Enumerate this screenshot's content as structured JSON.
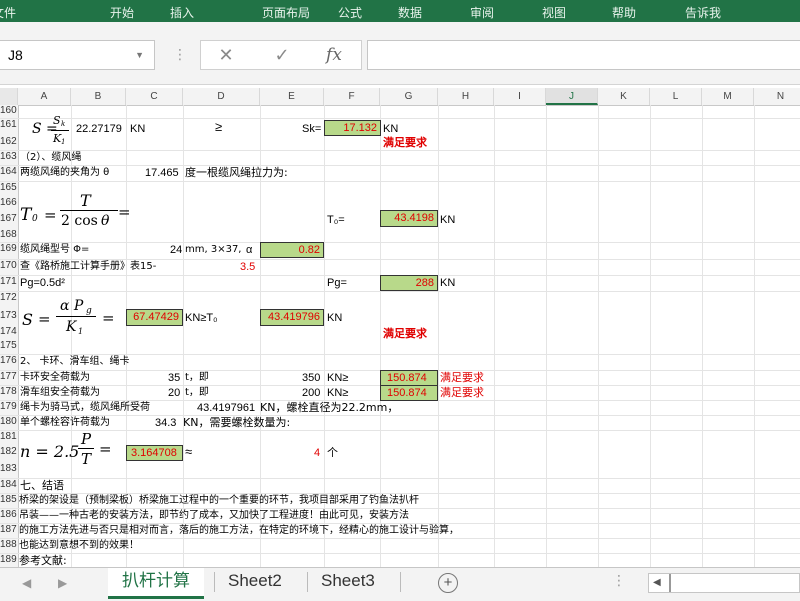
{
  "ribbon": {
    "tabs": [
      "文件",
      "开始",
      "插入",
      "页面布局",
      "公式",
      "数据",
      "审阅",
      "视图",
      "帮助",
      "告诉我"
    ]
  },
  "formula_bar": {
    "cell_ref": "J8",
    "cancel_symbol": "✕",
    "confirm_symbol": "✓",
    "fx_symbol": "fx",
    "formula_value": ""
  },
  "columns": [
    "A",
    "B",
    "C",
    "D",
    "E",
    "F",
    "G",
    "H",
    "I",
    "J",
    "K",
    "L",
    "M",
    "N"
  ],
  "selected_column": "J",
  "rows": [
    "160",
    "161",
    "162",
    "163",
    "164",
    "165",
    "166",
    "167",
    "168",
    "169",
    "170",
    "171",
    "172",
    "173",
    "174",
    "175",
    "176",
    "177",
    "178",
    "179",
    "180",
    "181",
    "182",
    "183",
    "184",
    "185",
    "186",
    "187",
    "188",
    "189"
  ],
  "cells": {
    "r161_s": "S =",
    "r161_sk": "S",
    "r161_sk_sub": "k",
    "r161_k1": "K",
    "r161_k1_sub": "1",
    "r161_b": "22.27179",
    "r161_c": "KN",
    "r161_d": "≥",
    "r161_e": "Sk=",
    "r161_f": "17.132",
    "r161_g": "KN",
    "r162_g": "满足要求",
    "r163_a": "（2）、缆风绳",
    "r164_a": "两缆风绳的夹角为 θ",
    "r164_c": "17.465",
    "r164_d": "度一根缆风绳拉力为:",
    "r167_t0": "T",
    "r167_t0_sub": "0",
    "r167_eq": "=",
    "r167_T": "T",
    "r167_den": "2 cos",
    "r167_theta": "θ",
    "r167_eq2": "=",
    "r167_f": "T₀=",
    "r167_g": "43.4198",
    "r167_h": "KN",
    "r169_a": "缆风绳型号 Φ=",
    "r169_c": "24",
    "r169_d": "mm, 3×37,",
    "r169_alpha": "α",
    "r169_e": "0.82",
    "r170_a": "查《路桥施工计算手册》表15-",
    "r170_d": "3.5",
    "r171_a": "Pg=0.5d²",
    "r171_f": "Pg=",
    "r171_g": "288",
    "r171_h": "KN",
    "r173_s": "S",
    "r173_eq": "=",
    "r173_num": "α P",
    "r173_num_sub": "g",
    "r173_den": "K",
    "r173_den_sub": "1",
    "r173_eq2": "=",
    "r173_c": "67.47429",
    "r173_d": "KN≥T₀",
    "r173_e": "43.419796",
    "r173_f": "KN",
    "r174_g": "满足要求",
    "r176_a": "2、 卡环、滑车组、绳卡",
    "r177_a": "卡环安全荷载为",
    "r177_c": "35",
    "r177_d": "t，即",
    "r177_e": "350",
    "r177_f": "KN≥",
    "r177_g": "150.874",
    "r177_h": "满足要求",
    "r178_a": "滑车组安全荷载为",
    "r178_c": "20",
    "r178_d": "t，即",
    "r178_e": "200",
    "r178_f": "KN≥",
    "r178_g": "150.874",
    "r178_h": "满足要求",
    "r179_a": "绳卡为骑马式，缆风绳所受荷",
    "r179_c": "43.4197961",
    "r179_d": "KN，螺栓直径为22.2mm，",
    "r180_a": "单个螺栓容许荷载为",
    "r180_c": "34.3",
    "r180_d": "KN，需要螺栓数量为:",
    "r182_n": "n = 2.5",
    "r182_P": "P",
    "r182_T": "T",
    "r182_eq": "=",
    "r182_c": "3.164708",
    "r182_d": "≈",
    "r182_e": "4",
    "r182_f": "个",
    "r184_a": "七、结语",
    "r185_a": "桥梁的架设是（预制梁板）桥梁施工过程中的一个重要的环节，我项目部采用了钓鱼法扒杆",
    "r186_a": "吊装——一种古老的安装方法，即节约了成本，又加快了工程进度！由此可见，安装方法",
    "r187_a": "的施工方法先进与否只是相对而言，落后的施工方法，在特定的环境下，经精心的施工设计与验算，",
    "r188_a": "也能达到意想不到的效果！",
    "r189_a": "参考文献:"
  },
  "sheets": {
    "tabs": [
      "扒杆计算",
      "Sheet2",
      "Sheet3"
    ],
    "active": "扒杆计算",
    "add_symbol": "+"
  },
  "colors": {
    "accent": "#217346",
    "highlight": "#b8d98a",
    "red": "#e00000"
  }
}
